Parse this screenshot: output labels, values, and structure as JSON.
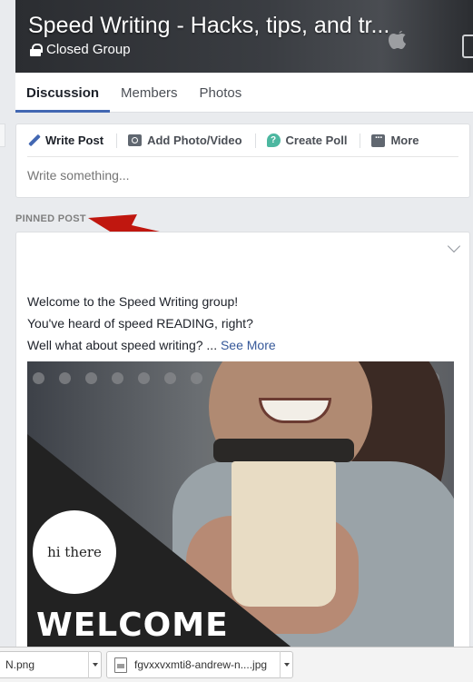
{
  "group": {
    "title": "Speed Writing - Hacks, tips, and tr...",
    "privacy": "Closed Group"
  },
  "tabs": [
    {
      "label": "Discussion",
      "active": true
    },
    {
      "label": "Members",
      "active": false
    },
    {
      "label": "Photos",
      "active": false
    }
  ],
  "composer": {
    "actions": [
      {
        "label": "Write Post",
        "icon": "pencil-icon"
      },
      {
        "label": "Add Photo/Video",
        "icon": "photo-icon"
      },
      {
        "label": "Create Poll",
        "icon": "poll-icon"
      },
      {
        "label": "More",
        "icon": "more-icon"
      }
    ],
    "placeholder": "Write something..."
  },
  "pinned": {
    "label": "PINNED POST",
    "arrow_color": "#c0170f"
  },
  "post": {
    "line1": "Welcome to the Speed Writing group!",
    "line2": "You've heard of speed READING, right?",
    "line3": "Well what about speed writing? ...",
    "see_more": "See More",
    "image": {
      "badge_text": "hi there",
      "headline": "WELCOME"
    }
  },
  "downloads": [
    {
      "name": "N.png"
    },
    {
      "name": "fgvxxvxmti8-andrew-n....jpg"
    }
  ],
  "colors": {
    "accent": "#4267b2",
    "link": "#365899",
    "background": "#e9ebee"
  }
}
